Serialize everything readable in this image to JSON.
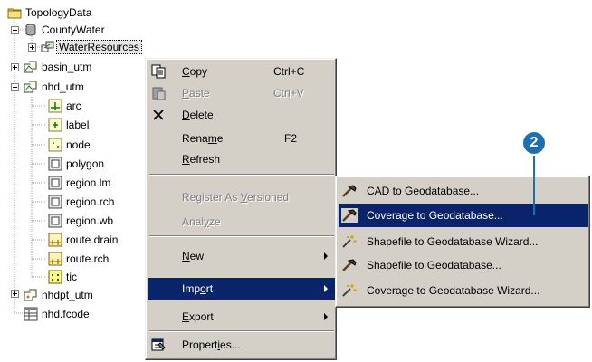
{
  "tree": {
    "root": "TopologyData",
    "database": "CountyWater",
    "dataset_selected": "WaterResources",
    "items": [
      {
        "label": "basin_utm"
      },
      {
        "label": "nhd_utm"
      },
      {
        "label": "arc"
      },
      {
        "label": "label"
      },
      {
        "label": "node"
      },
      {
        "label": "polygon"
      },
      {
        "label": "region.lm"
      },
      {
        "label": "region.rch"
      },
      {
        "label": "region.wb"
      },
      {
        "label": "route.drain"
      },
      {
        "label": "route.rch"
      },
      {
        "label": "tic"
      },
      {
        "label": "nhdpt_utm"
      },
      {
        "label": "nhd.fcode"
      }
    ]
  },
  "context_menu": {
    "copy": {
      "pre": "",
      "key": "C",
      "post": "opy",
      "shortcut": "Ctrl+C"
    },
    "paste": {
      "pre": "",
      "key": "P",
      "post": "aste",
      "shortcut": "Ctrl+V"
    },
    "delete": {
      "pre": "",
      "key": "D",
      "post": "elete"
    },
    "rename": {
      "pre": "Rena",
      "key": "m",
      "post": "e",
      "shortcut": "F2"
    },
    "refresh": {
      "pre": "",
      "key": "R",
      "post": "efresh"
    },
    "register": {
      "pre": "Register As ",
      "key": "V",
      "post": "ersioned"
    },
    "analyze": {
      "pre": "Anal",
      "key": "y",
      "post": "ze"
    },
    "new": {
      "pre": "",
      "key": "N",
      "post": "ew"
    },
    "import": {
      "pre": "Imp",
      "key": "o",
      "post": "rt"
    },
    "export": {
      "pre": "",
      "key": "E",
      "post": "xport"
    },
    "properties": {
      "pre": "Propert",
      "key": "i",
      "post": "es..."
    }
  },
  "import_submenu": [
    {
      "label": "CAD to Geodatabase..."
    },
    {
      "label": "Coverage to Geodatabase..."
    },
    {
      "label": "Shapefile to Geodatabase Wizard..."
    },
    {
      "label": "Shapefile to Geodatabase..."
    },
    {
      "label": "Coverage to Geodatabase Wizard..."
    }
  ],
  "callout_number": "2",
  "colors": {
    "menu_bg": "#d4d0c8",
    "highlight": "#0a246a",
    "callout": "#1e6fb0"
  }
}
